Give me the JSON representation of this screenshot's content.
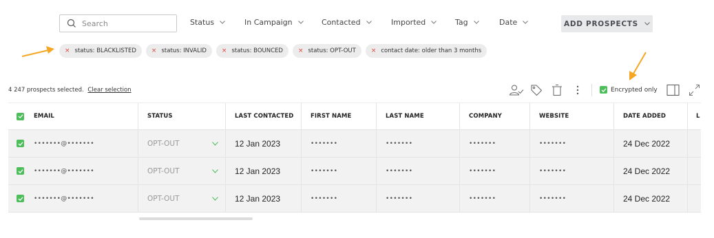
{
  "search": {
    "placeholder": "Search"
  },
  "filters": [
    {
      "label": "Status"
    },
    {
      "label": "In Campaign"
    },
    {
      "label": "Contacted"
    },
    {
      "label": "Imported"
    },
    {
      "label": "Tag"
    },
    {
      "label": "Date"
    }
  ],
  "add_button": {
    "label": "ADD PROSPECTS"
  },
  "chips": [
    {
      "label": "status: BLACKLISTED"
    },
    {
      "label": "status: INVALID"
    },
    {
      "label": "status: BOUNCED"
    },
    {
      "label": "status: OPT-OUT"
    },
    {
      "label": "contact date: older than 3 months"
    }
  ],
  "selection": {
    "text": "4 247 prospects selected.",
    "clear_label": "Clear selection"
  },
  "toolbar": {
    "icons": [
      "assign-user-icon",
      "tag-icon",
      "trash-icon",
      "more-vertical-icon",
      "columns-icon",
      "expand-icon"
    ],
    "encrypted_label": "Encrypted only",
    "encrypted_checked": true
  },
  "table": {
    "columns": [
      "EMAIL",
      "STATUS",
      "LAST CONTACTED",
      "FIRST NAME",
      "LAST NAME",
      "COMPANY",
      "WEBSITE",
      "DATE ADDED",
      "L"
    ],
    "rows": [
      {
        "email": "•••••••@•••••••",
        "status": "OPT-OUT",
        "last_contacted": "12 Jan 2023",
        "first_name": "•••••••",
        "last_name": "•••••••",
        "company": "•••••••",
        "website": "•••••••",
        "date_added": "24 Dec 2022"
      },
      {
        "email": "•••••••@•••••••",
        "status": "OPT-OUT",
        "last_contacted": "12 Jan 2023",
        "first_name": "•••••••",
        "last_name": "•••••••",
        "company": "•••••••",
        "website": "•••••••",
        "date_added": "24 Dec 2022"
      },
      {
        "email": "•••••••@•••••••",
        "status": "OPT-OUT",
        "last_contacted": "12 Jan 2023",
        "first_name": "•••••••",
        "last_name": "•••••••",
        "company": "•••••••",
        "website": "•••••••",
        "date_added": "24 Dec 2022"
      }
    ]
  },
  "colors": {
    "accent_green": "#4cbf5a",
    "arrow_orange": "#f5a623",
    "remove_red": "#e0443a"
  }
}
